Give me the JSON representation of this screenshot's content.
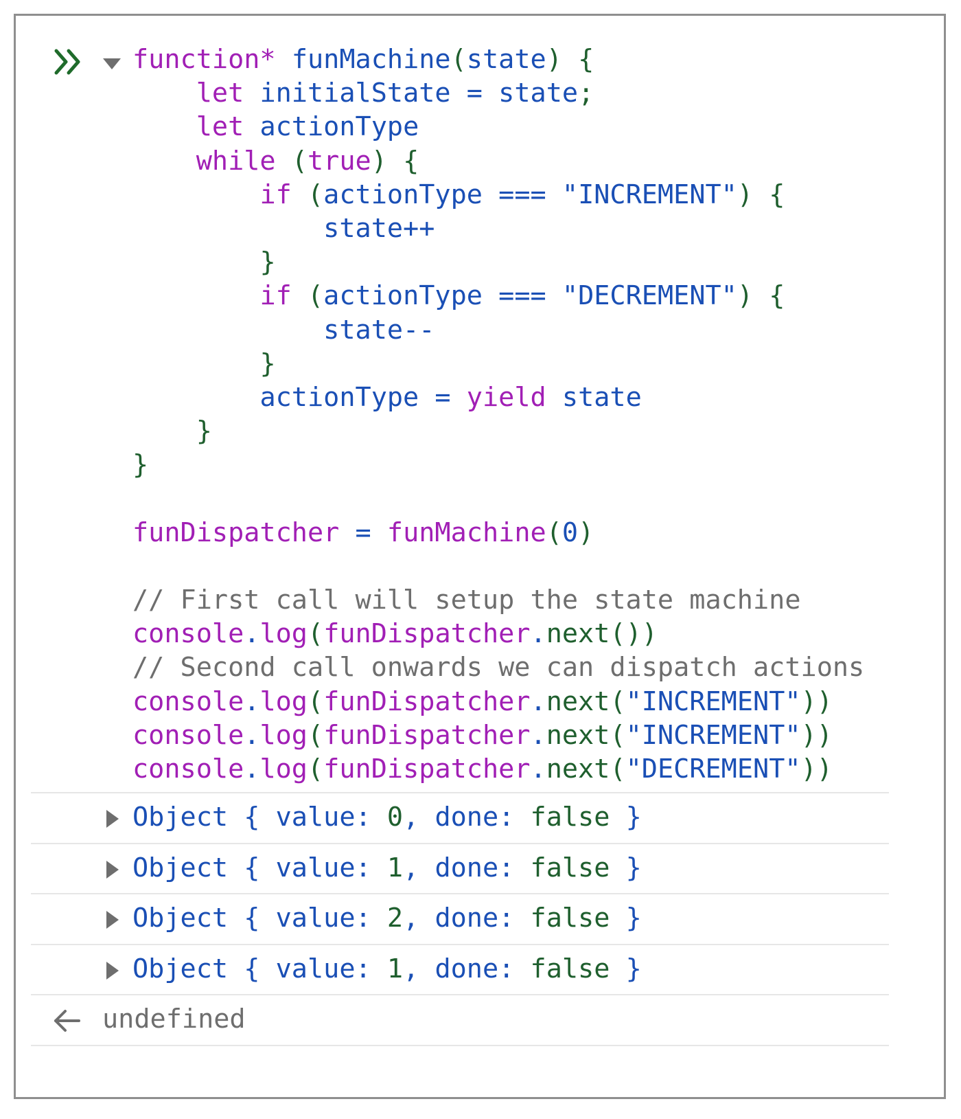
{
  "code_lines": [
    [
      {
        "t": "function*",
        "c": "kw"
      },
      {
        "t": " "
      },
      {
        "t": "funMachine",
        "c": "id"
      },
      {
        "t": "(",
        "c": "pun"
      },
      {
        "t": "state",
        "c": "id"
      },
      {
        "t": ")",
        "c": "pun"
      },
      {
        "t": " "
      },
      {
        "t": "{",
        "c": "pun"
      }
    ],
    [
      {
        "t": "    "
      },
      {
        "t": "let",
        "c": "kw"
      },
      {
        "t": " "
      },
      {
        "t": "initialState",
        "c": "id"
      },
      {
        "t": " "
      },
      {
        "t": "=",
        "c": "id"
      },
      {
        "t": " "
      },
      {
        "t": "state",
        "c": "id"
      },
      {
        "t": ";",
        "c": "pun"
      }
    ],
    [
      {
        "t": "    "
      },
      {
        "t": "let",
        "c": "kw"
      },
      {
        "t": " "
      },
      {
        "t": "actionType",
        "c": "id"
      }
    ],
    [
      {
        "t": "    "
      },
      {
        "t": "while",
        "c": "kw"
      },
      {
        "t": " "
      },
      {
        "t": "(",
        "c": "pun"
      },
      {
        "t": "true",
        "c": "kw"
      },
      {
        "t": ")",
        "c": "pun"
      },
      {
        "t": " "
      },
      {
        "t": "{",
        "c": "pun"
      }
    ],
    [
      {
        "t": "        "
      },
      {
        "t": "if",
        "c": "kw"
      },
      {
        "t": " "
      },
      {
        "t": "(",
        "c": "pun"
      },
      {
        "t": "actionType",
        "c": "id"
      },
      {
        "t": " "
      },
      {
        "t": "===",
        "c": "id"
      },
      {
        "t": " "
      },
      {
        "t": "\"INCREMENT\"",
        "c": "str"
      },
      {
        "t": ")",
        "c": "pun"
      },
      {
        "t": " "
      },
      {
        "t": "{",
        "c": "pun"
      }
    ],
    [
      {
        "t": "            "
      },
      {
        "t": "state++",
        "c": "id"
      }
    ],
    [
      {
        "t": "        "
      },
      {
        "t": "}",
        "c": "pun"
      }
    ],
    [
      {
        "t": "        "
      },
      {
        "t": "if",
        "c": "kw"
      },
      {
        "t": " "
      },
      {
        "t": "(",
        "c": "pun"
      },
      {
        "t": "actionType",
        "c": "id"
      },
      {
        "t": " "
      },
      {
        "t": "===",
        "c": "id"
      },
      {
        "t": " "
      },
      {
        "t": "\"DECREMENT\"",
        "c": "str"
      },
      {
        "t": ")",
        "c": "pun"
      },
      {
        "t": " "
      },
      {
        "t": "{",
        "c": "pun"
      }
    ],
    [
      {
        "t": "            "
      },
      {
        "t": "state--",
        "c": "id"
      }
    ],
    [
      {
        "t": "        "
      },
      {
        "t": "}",
        "c": "pun"
      }
    ],
    [
      {
        "t": "        "
      },
      {
        "t": "actionType",
        "c": "id"
      },
      {
        "t": " "
      },
      {
        "t": "=",
        "c": "id"
      },
      {
        "t": " "
      },
      {
        "t": "yield",
        "c": "kw"
      },
      {
        "t": " "
      },
      {
        "t": "state",
        "c": "id"
      }
    ],
    [
      {
        "t": "    "
      },
      {
        "t": "}",
        "c": "pun"
      }
    ],
    [
      {
        "t": "}",
        "c": "pun"
      }
    ],
    [],
    [
      {
        "t": "funDispatcher",
        "c": "kw"
      },
      {
        "t": " "
      },
      {
        "t": "=",
        "c": "id"
      },
      {
        "t": " "
      },
      {
        "t": "funMachine",
        "c": "kw"
      },
      {
        "t": "(",
        "c": "pun"
      },
      {
        "t": "0",
        "c": "num"
      },
      {
        "t": ")",
        "c": "pun"
      }
    ],
    [],
    [
      {
        "t": "// First call will setup the state machine",
        "c": "cm"
      }
    ],
    [
      {
        "t": "console",
        "c": "kw"
      },
      {
        "t": ".",
        "c": "id"
      },
      {
        "t": "log",
        "c": "kw"
      },
      {
        "t": "(",
        "c": "pun"
      },
      {
        "t": "funDispatcher",
        "c": "kw"
      },
      {
        "t": ".",
        "c": "id"
      },
      {
        "t": "next",
        "c": "grn"
      },
      {
        "t": "())",
        "c": "pun"
      }
    ],
    [
      {
        "t": "// Second call onwards we can dispatch actions",
        "c": "cm"
      }
    ],
    [
      {
        "t": "console",
        "c": "kw"
      },
      {
        "t": ".",
        "c": "id"
      },
      {
        "t": "log",
        "c": "kw"
      },
      {
        "t": "(",
        "c": "pun"
      },
      {
        "t": "funDispatcher",
        "c": "kw"
      },
      {
        "t": ".",
        "c": "id"
      },
      {
        "t": "next",
        "c": "grn"
      },
      {
        "t": "(",
        "c": "pun"
      },
      {
        "t": "\"INCREMENT\"",
        "c": "str"
      },
      {
        "t": "))",
        "c": "pun"
      }
    ],
    [
      {
        "t": "console",
        "c": "kw"
      },
      {
        "t": ".",
        "c": "id"
      },
      {
        "t": "log",
        "c": "kw"
      },
      {
        "t": "(",
        "c": "pun"
      },
      {
        "t": "funDispatcher",
        "c": "kw"
      },
      {
        "t": ".",
        "c": "id"
      },
      {
        "t": "next",
        "c": "grn"
      },
      {
        "t": "(",
        "c": "pun"
      },
      {
        "t": "\"INCREMENT\"",
        "c": "str"
      },
      {
        "t": "))",
        "c": "pun"
      }
    ],
    [
      {
        "t": "console",
        "c": "kw"
      },
      {
        "t": ".",
        "c": "id"
      },
      {
        "t": "log",
        "c": "kw"
      },
      {
        "t": "(",
        "c": "pun"
      },
      {
        "t": "funDispatcher",
        "c": "kw"
      },
      {
        "t": ".",
        "c": "id"
      },
      {
        "t": "next",
        "c": "grn"
      },
      {
        "t": "(",
        "c": "pun"
      },
      {
        "t": "\"DECREMENT\"",
        "c": "str"
      },
      {
        "t": "))",
        "c": "pun"
      }
    ]
  ],
  "outputs": [
    {
      "label": "Object",
      "value": "0",
      "done": "false"
    },
    {
      "label": "Object",
      "value": "1",
      "done": "false"
    },
    {
      "label": "Object",
      "value": "2",
      "done": "false"
    },
    {
      "label": "Object",
      "value": "1",
      "done": "false"
    }
  ],
  "output_keys": {
    "value": "value",
    "done": "done"
  },
  "return_value": "undefined",
  "colors": {
    "keyword": "#a11fb5",
    "identifier": "#1a4fb5",
    "punctuation": "#1f5f2e",
    "comment": "#6e6e6e",
    "border": "#8f8f8f",
    "separator": "#e6e6e6"
  }
}
